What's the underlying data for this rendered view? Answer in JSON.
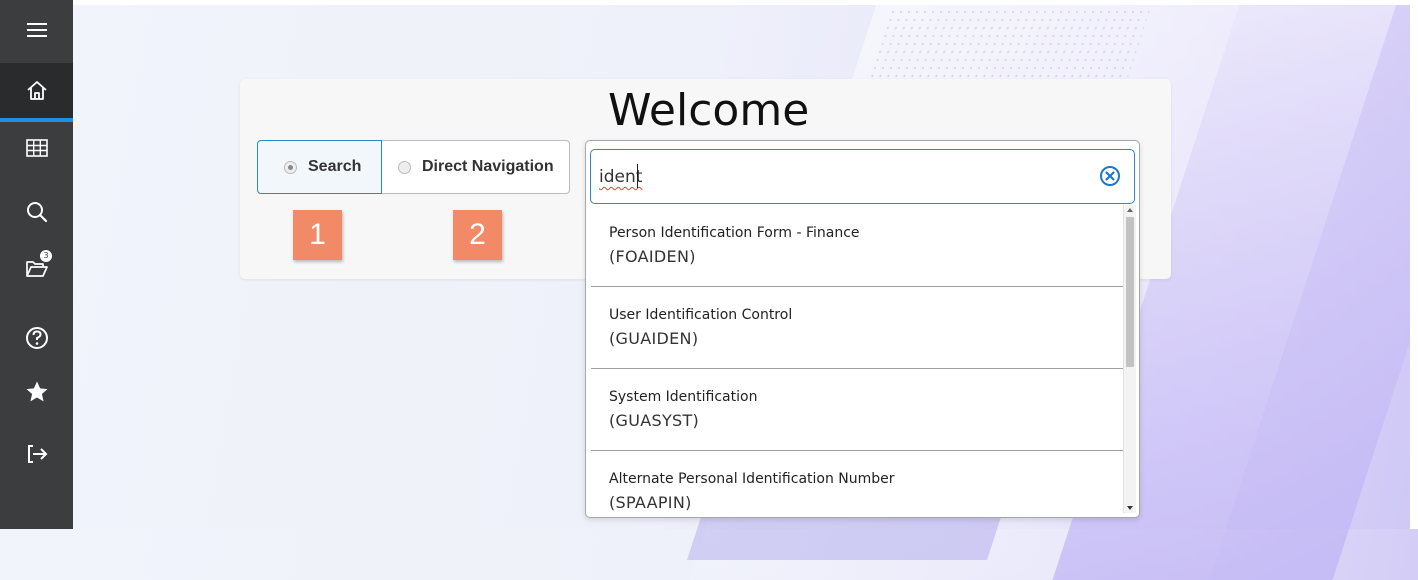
{
  "sidebar": {
    "items": [
      {
        "icon": "menu-icon",
        "active": false
      },
      {
        "icon": "home-icon",
        "active": true
      },
      {
        "icon": "grid-icon",
        "active": false
      },
      {
        "icon": "search-icon",
        "active": false
      },
      {
        "icon": "folder-icon",
        "active": false,
        "badge": "3"
      },
      {
        "icon": "help-icon",
        "active": false
      },
      {
        "icon": "star-icon",
        "active": false
      },
      {
        "icon": "sign-out-icon",
        "active": false
      }
    ]
  },
  "main": {
    "title": "Welcome",
    "mode_toggle": {
      "search_label": "Search",
      "direct_label": "Direct Navigation",
      "selected": "search"
    },
    "callouts": [
      "1",
      "2"
    ],
    "callout_color": "#f28a67"
  },
  "search": {
    "value": "ident",
    "results": [
      {
        "name": "Person Identification Form - Finance",
        "code": "(FOAIDEN)"
      },
      {
        "name": "User Identification Control",
        "code": "(GUAIDEN)"
      },
      {
        "name": "System Identification",
        "code": "(GUASYST)"
      },
      {
        "name": "Alternate Personal Identification Number",
        "code": "(SPAAPIN)"
      }
    ]
  },
  "colors": {
    "sidebar": "#3b3d3f",
    "accent": "#1e8fe1",
    "focus_border": "#2f86c9"
  }
}
